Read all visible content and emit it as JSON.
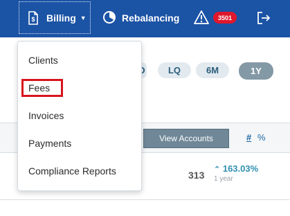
{
  "nav": {
    "billing_label": "Billing",
    "rebalancing_label": "Rebalancing",
    "alert_count": "3501",
    "icons": [
      "billing-doc-icon",
      "rebalancing-icon",
      "warning-icon",
      "logout-icon"
    ]
  },
  "menu": {
    "items": [
      "Clients",
      "Fees",
      "Invoices",
      "Payments",
      "Compliance Reports"
    ],
    "highlighted": "Fees"
  },
  "periods": {
    "hidden_chip": "D",
    "chips": [
      "LQ",
      "6M",
      "1Y"
    ],
    "selected": "1Y"
  },
  "table": {
    "view_accounts_label": "View Accounts",
    "hash_label": "#",
    "percent_label": "%",
    "count": "313",
    "change": "163.03%",
    "period": "1 year"
  },
  "colors": {
    "nav_bg": "#1b53a5",
    "badge": "#e0172b",
    "highlight_box": "#d7141d",
    "chip_active": "#8499a6"
  }
}
